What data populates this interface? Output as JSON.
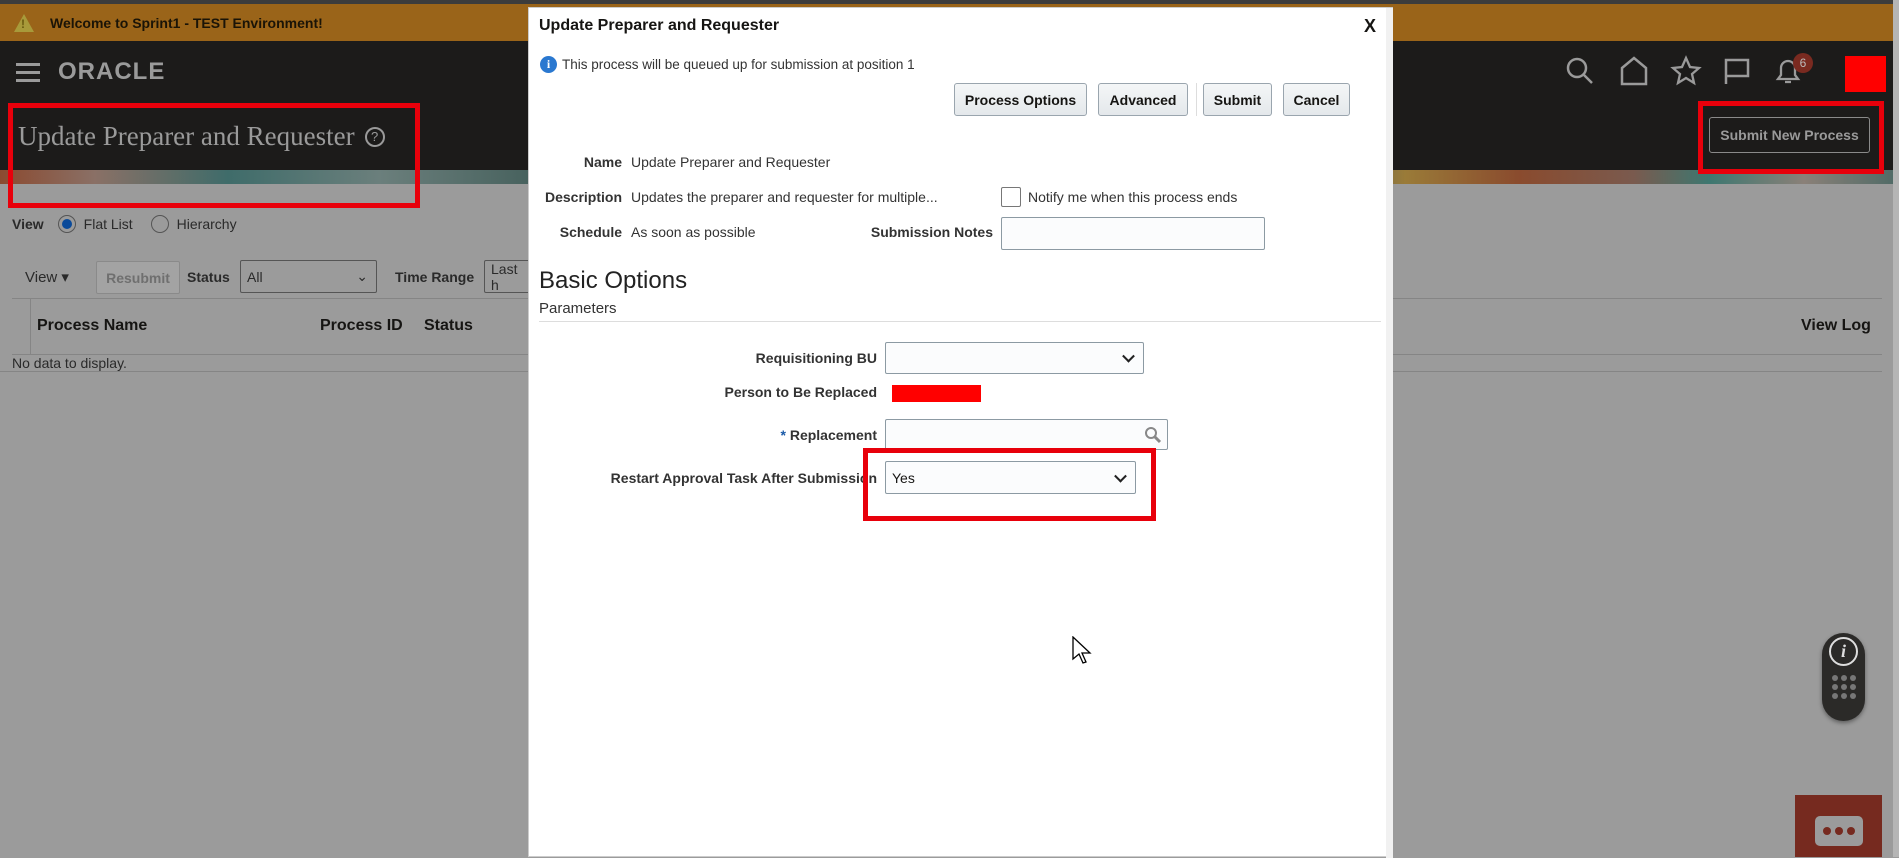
{
  "banner": {
    "text": "Welcome to Sprint1 - TEST Environment!"
  },
  "header": {
    "logo": "ORACLE",
    "page_title": "Update Preparer and Requester",
    "help_icon": "?",
    "notification_count": "6",
    "submit_new_process": "Submit New Process"
  },
  "background_page": {
    "view_label": "View",
    "view_options": [
      "Flat List",
      "Hierarchy"
    ],
    "view_selected": "Flat List",
    "toolbar": {
      "view_menu": "View",
      "resubmit": "Resubmit",
      "status_label": "Status",
      "status_value": "All",
      "time_range_label": "Time Range",
      "time_range_value": "Last h"
    },
    "table": {
      "columns": [
        "Process Name",
        "Process ID",
        "Status",
        "View Log"
      ],
      "empty_text": "No data to display."
    }
  },
  "dialog": {
    "title": "Update Preparer and Requester",
    "close": "X",
    "info": "This process will be queued up for submission at position 1",
    "buttons": {
      "process_options": "Process Options",
      "advanced": "Advanced",
      "submit": "Submit",
      "cancel": "Cancel"
    },
    "name_label": "Name",
    "name_value": "Update Preparer and Requester",
    "description_label": "Description",
    "description_value": "Updates the preparer and requester for multiple...",
    "notify_label": "Notify me when this process ends",
    "schedule_label": "Schedule",
    "schedule_value": "As soon as possible",
    "submission_notes_label": "Submission Notes",
    "submission_notes_value": "",
    "section_title": "Basic Options",
    "subsection": "Parameters",
    "params": {
      "req_bu_label": "Requisitioning BU",
      "req_bu_value": "",
      "person_label": "Person to Be Replaced",
      "required_mark": "*",
      "replacement_label": "Replacement",
      "replacement_value": "",
      "restart_label": "Restart Approval Task After Submission",
      "restart_value": "Yes"
    }
  },
  "colors": {
    "banner": "#9a6419",
    "header": "#1c1b1a",
    "annotation": "#e8000b",
    "redaction": "#ff0000"
  }
}
